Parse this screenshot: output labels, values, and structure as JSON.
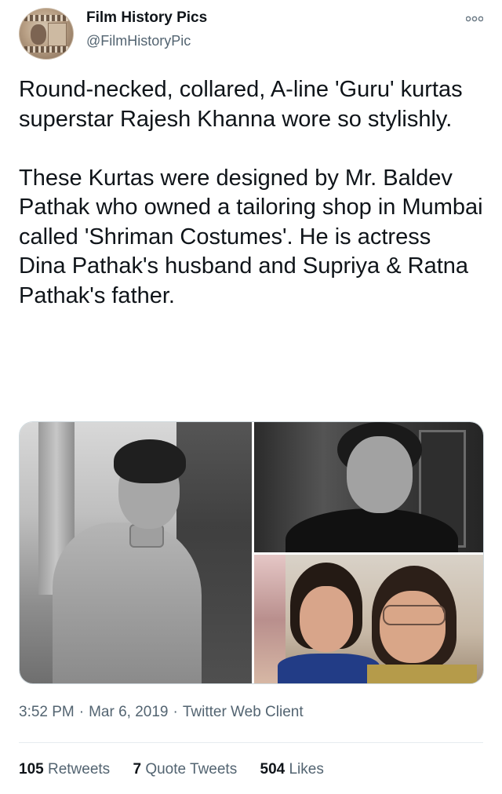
{
  "author": {
    "name": "Film History Pics",
    "handle": "@FilmHistoryPic",
    "avatar_icon": "film-strip-portrait-avatar"
  },
  "tweet": {
    "paragraphs": [
      "Round-necked, collared, A-line 'Guru' kurtas superstar Rajesh Khanna wore so stylishly.",
      "These Kurtas were designed by Mr. Baldev Pathak who owned a tailoring shop in Mumbai called 'Shriman Costumes'. He is actress Dina Pathak's husband and Supriya & Ratna Pathak's father."
    ]
  },
  "media": {
    "photos": [
      "black-and-white photo of man in kurta",
      "black-and-white photo of older woman smiling",
      "color photo of two young women"
    ]
  },
  "meta": {
    "time": "3:52 PM",
    "date": "Mar 6, 2019",
    "client": "Twitter Web Client",
    "separator": "·"
  },
  "stats": {
    "retweets_count": "105",
    "retweets_label": "Retweets",
    "quote_count": "7",
    "quote_label": "Quote Tweets",
    "likes_count": "504",
    "likes_label": "Likes"
  },
  "colors": {
    "primary_text": "#0f1419",
    "secondary_text": "#536471",
    "border": "#cfd9de",
    "divider": "#e6ecf0"
  }
}
